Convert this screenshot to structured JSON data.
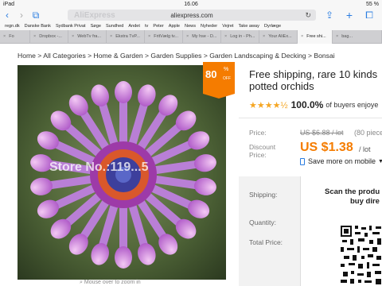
{
  "status_bar": {
    "device": "iPad",
    "time": "16.06",
    "battery": "55 %"
  },
  "browser": {
    "url": "aliexpress.com",
    "url_ghost": "AliExpress",
    "bookmarks": [
      "regn.dk",
      "Danske Bank",
      "Sydbank Privat",
      "Søge",
      "Sundhed",
      "Andet",
      "tv",
      "Peter",
      "Apple",
      "News",
      "Nyheder",
      "Vejret",
      "Take away",
      "Dyrlæge"
    ],
    "tabs": [
      "Fo",
      "Dropbox -...",
      "WebTv fra...",
      "Ekstra TvP...",
      "FritVælg tv...",
      "My hse - D...",
      "Log in - Ph...",
      "Your AliEx...",
      "Free shi...",
      "bag..."
    ]
  },
  "breadcrumb": "Home > All Categories > Home & Garden > Garden Supplies > Garden Landscaping & Decking > Bonsai",
  "badge": {
    "percent": "80",
    "symbol": "%",
    "off": "OFF"
  },
  "image": {
    "watermark": "Store No.:119...5",
    "zoom_hint": "Mouse over to zoom in"
  },
  "product": {
    "title_line1": "Free shipping, rare 10 kinds",
    "title_line2": "potted orchids",
    "rating_value": 4.5,
    "positive_pct": "100.0%",
    "positive_text": "of buyers enjoye"
  },
  "price": {
    "price_label": "Price:",
    "old": "US $6.88 / lot",
    "pieces": "(80 piece",
    "discount_label_1": "Discount",
    "discount_label_2": "Price:",
    "new": "US $1.38",
    "per_lot": "/ lot",
    "mobile_text": "Save more on mobile"
  },
  "details": {
    "shipping": "Shipping:",
    "quantity": "Quantity:",
    "total": "Total Price:"
  },
  "popup": {
    "scan": "Scan the produ",
    "buy": "buy dire"
  },
  "colors": {
    "accent": "#f57c00",
    "link": "#2a7de1"
  }
}
